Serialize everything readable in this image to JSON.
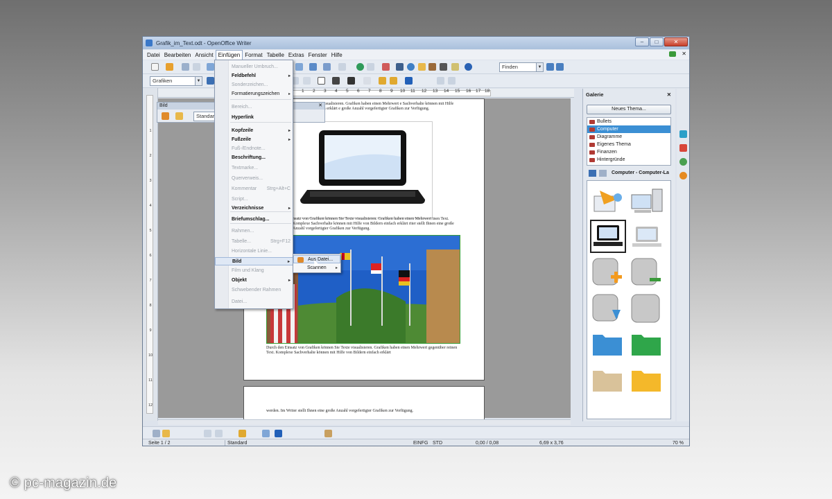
{
  "window": {
    "title": "Grafik_im_Text.odt - OpenOffice Writer",
    "min": "–",
    "max": "□",
    "close": "✕"
  },
  "menubar": [
    "Datei",
    "Bearbeiten",
    "Ansicht",
    "Einfügen",
    "Format",
    "Tabelle",
    "Extras",
    "Fenster",
    "Hilfe"
  ],
  "toolbar": {
    "find_placeholder": "Finden",
    "style_combo": "Grafiken"
  },
  "bild_toolbar": {
    "title": "Bild",
    "combo": "Standard"
  },
  "ruler": [
    "1",
    "2",
    "3",
    "4",
    "5",
    "6",
    "7",
    "8",
    "9",
    "10",
    "11",
    "12",
    "13",
    "14",
    "15",
    "16",
    "17",
    "18"
  ],
  "vruler": [
    "1",
    "2",
    "3",
    "4",
    "5",
    "6",
    "7",
    "8",
    "9",
    "10",
    "11",
    "12"
  ],
  "insert_menu": [
    {
      "label": "Manueller Umbruch...",
      "disabled": true
    },
    {
      "label": "Feldbefehl",
      "bold": true,
      "sub": true
    },
    {
      "label": "Sonderzeichen...",
      "disabled": true
    },
    {
      "label": "Formatierungszeichen",
      "sub": true
    },
    {
      "label": "Bereich...",
      "disabled": true
    },
    {
      "label": "Hyperlink",
      "bold": true
    },
    {
      "label": "Kopfzeile",
      "bold": true,
      "sub": true
    },
    {
      "label": "Fußzeile",
      "bold": true,
      "sub": true
    },
    {
      "label": "Fuß-/Endnote...",
      "disabled": true
    },
    {
      "label": "Beschriftung...",
      "bold": true
    },
    {
      "label": "Textmarke...",
      "disabled": true
    },
    {
      "label": "Querverweis...",
      "disabled": true
    },
    {
      "label": "Kommentar",
      "disabled": true,
      "shortcut": "Strg+Alt+C"
    },
    {
      "label": "Script...",
      "disabled": true
    },
    {
      "label": "Verzeichnisse",
      "bold": true,
      "sub": true
    },
    {
      "label": "Briefumschlag...",
      "bold": true
    },
    {
      "label": "Rahmen...",
      "disabled": true
    },
    {
      "label": "Tabelle...",
      "disabled": true,
      "shortcut": "Strg+F12"
    },
    {
      "label": "Horizontale Linie...",
      "disabled": true
    },
    {
      "label": "Bild",
      "bold": true,
      "sub": true
    },
    {
      "label": "Film und Klang",
      "disabled": true
    },
    {
      "label": "Objekt",
      "bold": true,
      "sub": true
    },
    {
      "label": "Schwebender Rahmen",
      "disabled": true
    },
    {
      "label": "Datei...",
      "disabled": true
    }
  ],
  "submenu": [
    {
      "label": "Aus Datei..."
    },
    {
      "label": "Scannen"
    }
  ],
  "document": {
    "text_top": "können Sie Texte visualisieren. Grafiken haben einen Mehrwert e Sachverhalte können mit Hilfe von Bildern einfach erklärt e große Anzahl vorgefertigter Grafiken zur Verfügung.",
    "text_mid": "nsatz von Grafiken können Sie Texte visualisieren. Grafiken haben einen Mehrwert inen Text. Komplexe Sachverhalte können mit Hilfe von Bildern einfach erklärt riter stellt Ihnen eine große Anzahl vorgefertigter Grafiken zur Verfügung.",
    "text_bottom": "Durch den Einsatz von Grafiken können Sie Texte visualisieren. Grafiken haben einen Mehrwert gegenüber reinen Text. Komplexe Sachverhalte können mit Hilfe von Bildern einfach erklärt",
    "text_page2": "werden. Im Writer stellt Ihnen eine große Anzahl vorgefertigter Grafiken zur Verfügung."
  },
  "gallery": {
    "title": "Galerie",
    "new_theme": "Neues Thema...",
    "themes": [
      "Bullets",
      "Computer",
      "Diagramme",
      "Eigenes Thema",
      "Finanzen",
      "Hintergründe"
    ],
    "selected_theme": "Computer",
    "view_title": "Computer - Computer-La"
  },
  "status": {
    "page": "Seite 1 / 2",
    "style": "Standard",
    "mode1": "EINFG",
    "mode2": "STD",
    "pos": "0,00 / 0,08",
    "size": "6,69 x 3,76",
    "zoom": "70 %"
  },
  "watermark": "© pc-magazin.de",
  "colors": {
    "selection": "#3b8fd4",
    "accent": "#3a78c8"
  }
}
